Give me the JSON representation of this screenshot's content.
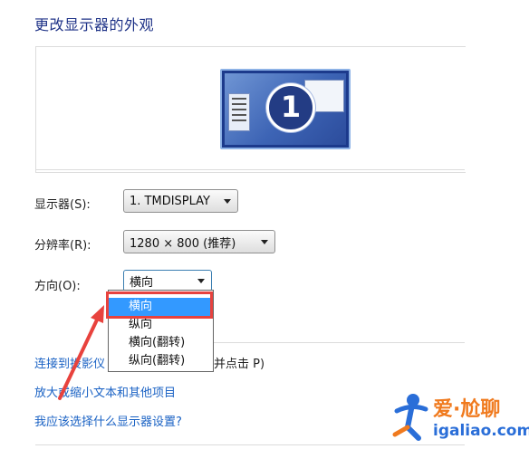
{
  "page": {
    "title": "更改显示器的外观"
  },
  "preview": {
    "monitor_number": "1"
  },
  "settings": {
    "display": {
      "label": "显示器(S):",
      "value": "1. TMDISPLAY"
    },
    "resolution": {
      "label": "分辨率(R):",
      "value": "1280 × 800 (推荐)"
    },
    "orientation": {
      "label": "方向(O):",
      "value": "横向",
      "options": [
        "横向",
        "纵向",
        "横向(翻转)",
        "纵向(翻转)"
      ],
      "selected_index": 0
    }
  },
  "links": {
    "projector": "连接到投影仪",
    "projector_fragment": "(",
    "projector_suffix": "并点击 P)",
    "text_size": "放大或缩小文本和其他项目",
    "which_settings": "我应该选择什么显示器设置?"
  },
  "watermark": {
    "brand": "爱·尬聊",
    "url": "igaliao.com"
  },
  "colors": {
    "title": "#1e3287",
    "link": "#1a62c4",
    "highlight": "#3399ff",
    "annotation_red": "#e8423d"
  }
}
